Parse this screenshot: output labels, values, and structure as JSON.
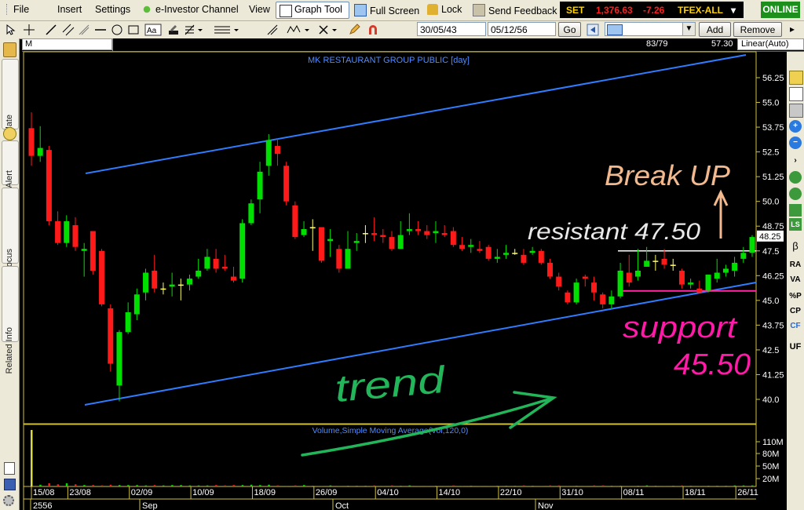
{
  "menu": {
    "items": [
      "File",
      "Insert",
      "Settings",
      "e-Investor Channel",
      "View",
      "Graph Tool",
      "Full Screen",
      "Lock",
      "Send Feedback"
    ],
    "active": "Graph Tool"
  },
  "ticker": {
    "index": "SET",
    "value": "1,376.63",
    "change": "-7.26",
    "market": "TFEX-ALL"
  },
  "status": "ONLINE",
  "toolbar": {
    "start_date": "30/05/43",
    "end_date": "05/12/56",
    "go_label": "Go",
    "add_label": "Add",
    "remove_label": "Remove"
  },
  "side_tabs": [
    "Template",
    "Alert",
    "Stock Focus",
    "Related Info"
  ],
  "chart_header": {
    "symbol": "M",
    "bar_counter": "83/79",
    "last_price": "57.30",
    "scale_mode": "Linear(Auto)"
  },
  "right_tools": [
    "LS",
    "β",
    "RA",
    "VA",
    "%P",
    "CP",
    "CF",
    "UF"
  ],
  "colors": {
    "up": "#00e000",
    "down": "#ff1a1a",
    "doji": "#ffff66",
    "trend_line": "#2f7cff",
    "axis": "#d0c040",
    "volume": "#d9d94a"
  },
  "chart_data": [
    {
      "type": "candlestick",
      "title": "MK RESTAURANT GROUP PUBLIC [day]",
      "y_ticks": [
        56.25,
        55,
        53.75,
        52.5,
        51.25,
        50,
        48.75,
        47.5,
        46.25,
        45,
        43.75,
        42.5,
        41.25,
        40
      ],
      "ylim": [
        39.5,
        57.3
      ],
      "last_price_label": "48.25",
      "x_ticks": [
        "15/08",
        "23/08",
        "02/09",
        "10/09",
        "18/09",
        "26/09",
        "04/10",
        "14/10",
        "22/10",
        "31/10",
        "08/11",
        "18/11",
        "26/11"
      ],
      "month_labels": [
        "2556",
        "Sep",
        "Oct",
        "Nov"
      ],
      "candles": [
        [
          53.7,
          52.3,
          54.5,
          51.8
        ],
        [
          52.3,
          52.7,
          53.8,
          52.0
        ],
        [
          52.6,
          49.0,
          52.8,
          48.8
        ],
        [
          49.0,
          47.9,
          49.5,
          47.8
        ],
        [
          47.9,
          49.0,
          49.3,
          47.7
        ],
        [
          48.8,
          47.7,
          49.2,
          47.5
        ],
        [
          47.5,
          47.6,
          47.9,
          46.2
        ],
        [
          48.5,
          46.5,
          48.5,
          46.3
        ],
        [
          47.5,
          44.8,
          47.6,
          44.7
        ],
        [
          44.6,
          41.8,
          44.8,
          41.4
        ],
        [
          40.7,
          43.4,
          43.5,
          39.9
        ],
        [
          43.4,
          44.4,
          44.9,
          43.3
        ],
        [
          44.3,
          45.3,
          45.6,
          44.0
        ],
        [
          45.4,
          46.4,
          46.6,
          45.0
        ],
        [
          46.5,
          45.6,
          47.3,
          45.4
        ],
        [
          45.6,
          45.6,
          45.9,
          45.3
        ],
        [
          45.7,
          45.8,
          46.4,
          45.2
        ],
        [
          45.8,
          45.8,
          46.1,
          45.0
        ],
        [
          45.8,
          46.1,
          46.3,
          45.5
        ],
        [
          46.2,
          46.5,
          47.1,
          46.1
        ],
        [
          46.6,
          47.2,
          47.6,
          46.5
        ],
        [
          47.1,
          46.6,
          47.6,
          46.4
        ],
        [
          46.7,
          46.6,
          47.3,
          46.5
        ],
        [
          46.2,
          46.0,
          46.7,
          45.9
        ],
        [
          46.1,
          48.9,
          49.1,
          45.9
        ],
        [
          48.9,
          49.9,
          50.1,
          48.8
        ],
        [
          50.1,
          51.5,
          52.0,
          49.4
        ],
        [
          51.8,
          53.1,
          53.4,
          51.3
        ],
        [
          52.8,
          52.4,
          53.2,
          51.8
        ],
        [
          51.8,
          50.0,
          52.0,
          49.8
        ],
        [
          49.8,
          48.2,
          50.0,
          48.1
        ],
        [
          48.3,
          48.6,
          49.0,
          48.2
        ],
        [
          48.7,
          48.7,
          49.1,
          47.5
        ],
        [
          48.7,
          47.0,
          48.7,
          46.9
        ],
        [
          48.0,
          48.1,
          48.6,
          47.2
        ],
        [
          47.6,
          46.6,
          47.8,
          46.4
        ],
        [
          46.6,
          47.6,
          48.5,
          46.6
        ],
        [
          47.9,
          48.0,
          48.4,
          47.5
        ],
        [
          48.4,
          48.4,
          48.8,
          47.9
        ],
        [
          48.4,
          48.3,
          49.2,
          48.0
        ],
        [
          48.3,
          48.2,
          48.6,
          47.9
        ],
        [
          48.2,
          47.6,
          48.5,
          47.5
        ],
        [
          47.6,
          48.3,
          49.0,
          47.6
        ],
        [
          48.5,
          48.6,
          49.4,
          48.3
        ],
        [
          48.6,
          48.5,
          49.0,
          48.3
        ],
        [
          48.5,
          48.3,
          48.8,
          48.1
        ],
        [
          48.4,
          48.5,
          49.0,
          47.9
        ],
        [
          48.4,
          48.3,
          48.8,
          48.2
        ],
        [
          48.5,
          47.8,
          48.7,
          47.7
        ],
        [
          47.8,
          47.6,
          48.2,
          47.5
        ],
        [
          47.7,
          47.8,
          48.1,
          47.4
        ],
        [
          47.6,
          47.5,
          48.0,
          47.4
        ],
        [
          47.7,
          47.1,
          47.8,
          47.0
        ],
        [
          47.1,
          47.2,
          47.6,
          46.9
        ],
        [
          47.3,
          47.4,
          47.8,
          47.1
        ],
        [
          47.4,
          47.4,
          47.6,
          47.3
        ],
        [
          47.3,
          46.9,
          47.6,
          46.8
        ],
        [
          47.4,
          47.5,
          47.7,
          47.3
        ],
        [
          47.5,
          46.9,
          47.6,
          46.8
        ],
        [
          46.9,
          46.2,
          47.1,
          46.1
        ],
        [
          46.2,
          45.7,
          46.4,
          45.5
        ],
        [
          45.4,
          44.9,
          45.5,
          44.8
        ],
        [
          44.9,
          45.9,
          46.1,
          44.8
        ],
        [
          46.2,
          46.1,
          46.3,
          45.7
        ],
        [
          45.9,
          45.4,
          46.2,
          45.0
        ],
        [
          45.3,
          44.8,
          45.4,
          44.6
        ],
        [
          44.8,
          45.2,
          45.5,
          44.6
        ],
        [
          45.2,
          46.5,
          46.9,
          45.1
        ],
        [
          46.4,
          45.9,
          47.3,
          45.7
        ],
        [
          46.2,
          46.5,
          47.6,
          46.0
        ],
        [
          46.7,
          47.0,
          47.7,
          46.7
        ],
        [
          47.0,
          47.0,
          47.3,
          46.5
        ],
        [
          47.1,
          46.8,
          47.6,
          46.6
        ],
        [
          46.8,
          46.8,
          47.1,
          46.5
        ],
        [
          46.5,
          45.8,
          46.6,
          45.6
        ],
        [
          45.8,
          45.9,
          46.1,
          45.6
        ],
        [
          45.6,
          45.4,
          46.0,
          45.4
        ],
        [
          45.5,
          46.3,
          46.3,
          45.4
        ],
        [
          46.1,
          46.4,
          47.1,
          45.9
        ],
        [
          46.4,
          46.6,
          46.8,
          46.2
        ],
        [
          46.5,
          46.9,
          47.2,
          46.2
        ],
        [
          47.1,
          47.4,
          47.7,
          46.9
        ],
        [
          47.4,
          48.2,
          48.3,
          47.2
        ]
      ],
      "annotations": [
        "Break UP",
        "resistant 47.50",
        "support",
        "45.50",
        "trend"
      ]
    },
    {
      "type": "bar",
      "title": "Volume,Simple Moving Average(Vol,120,0)",
      "y_ticks": [
        "110M",
        "80M",
        "50M",
        "20M"
      ],
      "values": [
        160,
        5,
        9,
        6,
        9,
        6,
        4,
        4,
        3,
        5,
        4,
        4,
        4,
        3,
        4,
        3,
        4,
        4,
        3,
        3,
        3,
        4,
        3,
        4,
        4,
        5,
        4,
        5,
        3,
        2,
        3,
        4,
        2,
        2,
        3,
        2,
        2,
        2,
        2,
        3,
        2,
        3,
        2,
        3,
        2,
        2,
        2,
        2,
        3,
        2,
        2,
        2,
        2,
        2,
        2,
        2,
        3,
        2,
        2,
        3,
        3,
        2,
        2,
        2,
        3,
        3,
        2,
        2,
        2,
        2,
        3,
        2,
        2,
        2,
        3,
        2,
        2,
        2,
        2,
        2,
        3,
        3,
        3
      ]
    }
  ]
}
